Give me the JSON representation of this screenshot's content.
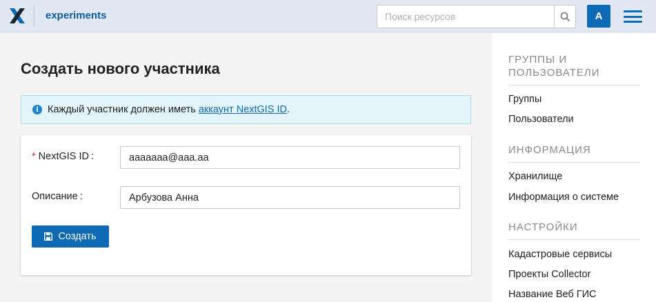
{
  "header": {
    "app_name": "experiments",
    "search_placeholder": "Поиск ресурсов",
    "avatar_letter": "A",
    "accent_color": "#0f6ab5",
    "background_color": "#dfe8f3"
  },
  "main": {
    "title": "Создать нового участника",
    "info": {
      "text": "Каждый участник должен иметь ",
      "link_text": "аккаунт NextGIS ID",
      "suffix": "."
    },
    "form": {
      "nextgis_id_label": "NextGIS ID",
      "nextgis_id_value": "aaaaaaa@aaa.aa",
      "description_label": "Описание",
      "description_value": "Арбузова Анна",
      "label_suffix": ":",
      "required_mark": "*",
      "submit_label": "Создать"
    }
  },
  "sidebar": {
    "groups_heading": "ГРУППЫ И ПОЛЬЗОВАТЕЛИ",
    "groups_items": [
      "Группы",
      "Пользователи"
    ],
    "info_heading": "ИНФОРМАЦИЯ",
    "info_items": [
      "Хранилище",
      "Информация о системе"
    ],
    "settings_heading": "НАСТРОЙКИ",
    "settings_items": [
      "Кадастровые сервисы",
      "Проекты Collector",
      "Название Веб ГИС"
    ]
  },
  "icons": [
    "logo-icon",
    "search-icon",
    "menu-icon",
    "info-icon",
    "save-icon"
  ]
}
